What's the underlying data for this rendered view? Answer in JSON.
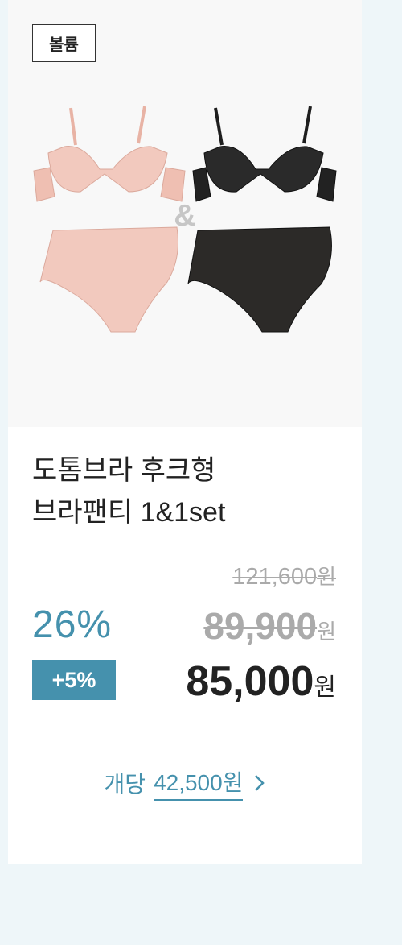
{
  "product": {
    "badge": "볼륨",
    "title_line1": "도톰브라 후크형",
    "title_line2": "브라팬티 1&1set",
    "image_alt": "pink and black bra and panty set",
    "ampersand": "&"
  },
  "pricing": {
    "original_price": "121,600",
    "original_currency": "원",
    "discount_percent": "26%",
    "sale_price": "89,900",
    "sale_currency": "원",
    "extra_discount": "+5%",
    "final_price": "85,000",
    "final_currency": "원"
  },
  "per_unit": {
    "label": "개당",
    "price": "42,500원",
    "icon": "chevron-right-icon"
  },
  "colors": {
    "accent": "#4591ad",
    "pink": "#f2c9be",
    "black": "#2a2a2a",
    "background": "#eef6f9"
  }
}
